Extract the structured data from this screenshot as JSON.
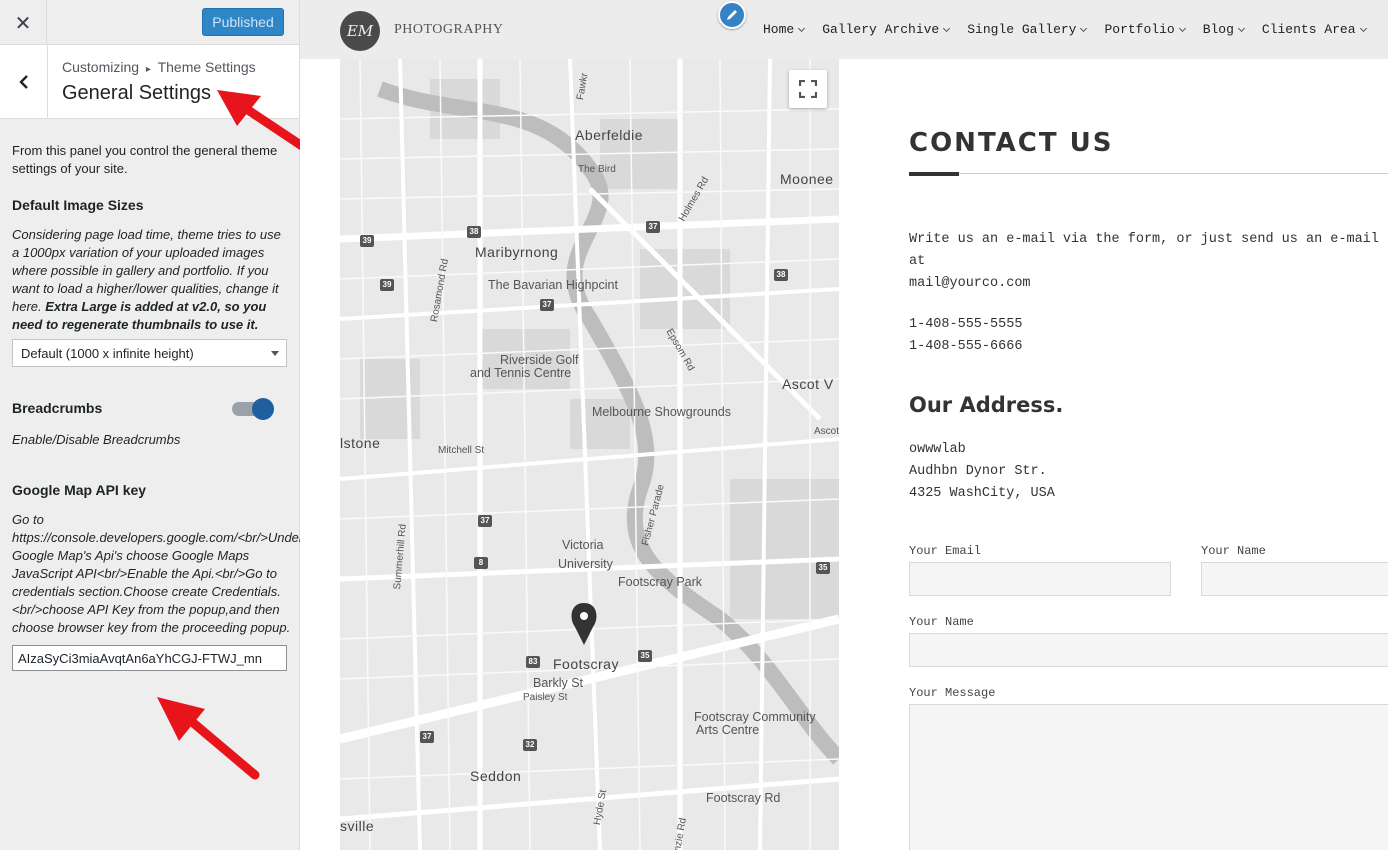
{
  "customizer": {
    "close_label": "✕",
    "publish_label": "Published",
    "breadcrumb_root": "Customizing",
    "breadcrumb_sep": "▸",
    "breadcrumb_parent": "Theme Settings",
    "section_title": "General Settings",
    "intro": "From this panel you control the general theme settings of your site.",
    "image_sizes": {
      "title": "Default Image Sizes",
      "desc": "Considering page load time, theme tries to use a 1000px variation of your uploaded images where possible in gallery and portfolio. If you want to load a higher/lower qualities, change it here.",
      "desc_bold": "Extra Large is added at v2.0, so you need to regenerate thumbnails to use it.",
      "selected": "Default (1000 x infinite height)"
    },
    "breadcrumbs": {
      "title": "Breadcrumbs",
      "enabled": true,
      "desc": "Enable/Disable Breadcrumbs"
    },
    "google_map": {
      "title": "Google Map API key",
      "desc": "Go to https://console.developers.google.com/<br/>Under Google Map's Api's choose Google Maps JavaScript API<br/>Enable the Api.<br/>Go to credentials section.Choose create Credentials.<br/>choose API Key from the popup,and then choose browser key from the proceeding popup.",
      "value": "AIzaSyCi3miaAvqtAn6aYhCGJ-FTWJ_mn"
    }
  },
  "site": {
    "logo_monogram": "EM",
    "logo_text": "PHOTOGRAPHY",
    "nav": [
      "Home",
      "Gallery Archive",
      "Single Gallery",
      "Portfolio",
      "Blog",
      "Clients Area"
    ],
    "map": {
      "places": [
        {
          "text": "Aberfeldie",
          "cls": "big"
        },
        {
          "text": "Moonee",
          "cls": "big"
        },
        {
          "text": "Maribyrnong",
          "cls": "big"
        },
        {
          "text": "The Bavarian Highpcint",
          "cls": ""
        },
        {
          "text": "Riverside Golf",
          "cls": ""
        },
        {
          "text": "and Tennis Centre",
          "cls": ""
        },
        {
          "text": "Ascot V",
          "cls": "big"
        },
        {
          "text": "Melbourne Showgrounds",
          "cls": ""
        },
        {
          "text": "lstone",
          "cls": "big"
        },
        {
          "text": "Mitchell St",
          "cls": "road"
        },
        {
          "text": "Victoria",
          "cls": ""
        },
        {
          "text": "University",
          "cls": ""
        },
        {
          "text": "Footscray Park",
          "cls": ""
        },
        {
          "text": "Footscray",
          "cls": "big"
        },
        {
          "text": "Barkly St",
          "cls": ""
        },
        {
          "text": "Paisley St",
          "cls": "road"
        },
        {
          "text": "Footscray Community",
          "cls": ""
        },
        {
          "text": "Arts Centre",
          "cls": ""
        },
        {
          "text": "Seddon",
          "cls": "big"
        },
        {
          "text": "Footscray Rd",
          "cls": ""
        },
        {
          "text": "sville",
          "cls": "big"
        },
        {
          "text": "The Bird",
          "cls": "road"
        },
        {
          "text": "Holmes Rd",
          "cls": "road"
        },
        {
          "text": "Epsom Rd",
          "cls": "road"
        },
        {
          "text": "Ascot",
          "cls": "road"
        },
        {
          "text": "Rosamond Rd",
          "cls": "road"
        },
        {
          "text": "Fisher Parade",
          "cls": "road"
        },
        {
          "text": "Summerhill Rd",
          "cls": "road"
        },
        {
          "text": "Hyde St",
          "cls": "road"
        },
        {
          "text": "Mckenzie Rd",
          "cls": "road"
        },
        {
          "text": "Fawkr",
          "cls": "road"
        }
      ],
      "shields": [
        "38",
        "37",
        "39",
        "39",
        "37",
        "38",
        "37",
        "8",
        "83",
        "35",
        "35",
        "37",
        "32"
      ]
    },
    "contact": {
      "title": "CONTACT US",
      "intro_line1": "Write us an e-mail via the form, or just send us an e-mail d",
      "intro_line2": "at",
      "email": "mail@yourco.com",
      "phone1": "1-408-555-5555",
      "phone2": "1-408-555-6666",
      "address_title": "Our Address.",
      "addr1": "owwwlab",
      "addr2": "Audhbn Dynor Str.",
      "addr3": "4325 WashCity, USA",
      "form": {
        "email_label": "Your Email",
        "name_label": "Your Name",
        "name_label_2": "Your Name",
        "message_label": "Your Message"
      }
    }
  },
  "colors": {
    "publish": "#2f86c6",
    "toggle_on": "#1e5fa0",
    "arrow": "#e8141b"
  }
}
